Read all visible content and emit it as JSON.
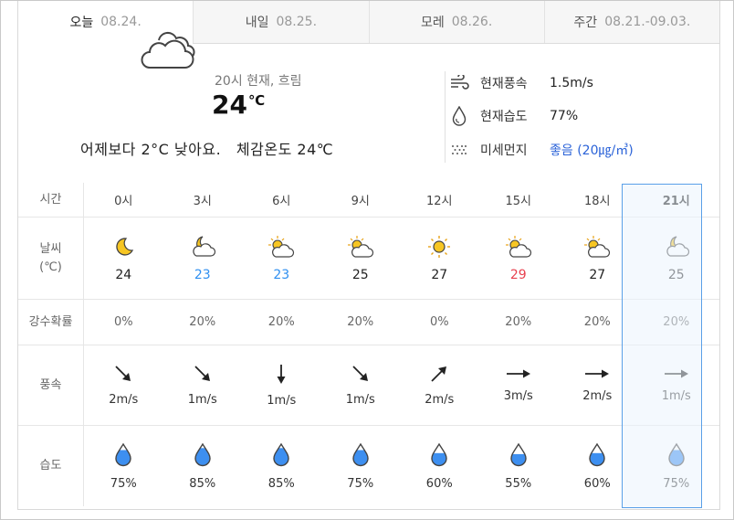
{
  "tabs": [
    {
      "label": "오늘",
      "date": "08.24.",
      "active": true
    },
    {
      "label": "내일",
      "date": "08.25.",
      "active": false
    },
    {
      "label": "모레",
      "date": "08.26.",
      "active": false
    },
    {
      "label": "주간",
      "date": "08.21.-09.03.",
      "active": false
    }
  ],
  "current": {
    "desc": "20시 현재, 흐림",
    "temp": "24",
    "unit": "℃",
    "compare": "어제보다 2°C 낮아요.",
    "feels": "체감온도 24℃",
    "icon": "cloudy-icon",
    "wind_label": "현재풍속",
    "wind_value": "1.5m/s",
    "humidity_label": "현재습도",
    "humidity_value": "77%",
    "dust_label": "미세먼지",
    "dust_value": "좋음 (20㎍/㎥)",
    "dust_color": "#2b63d8"
  },
  "rows": {
    "time_label": "시간",
    "weather_label": "날씨\n(℃)",
    "weather_label_1": "날씨",
    "weather_label_2": "(℃)",
    "rain_label": "강수확률",
    "wind_label": "풍속",
    "humidity_label": "습도"
  },
  "hours": [
    {
      "time": "0시",
      "icon": "moon-icon",
      "temp": "24",
      "temp_class": "",
      "rain": "0%",
      "wind_dir": "arrow-down-right-icon",
      "wind": "2m/s",
      "humidity": "75%"
    },
    {
      "time": "3시",
      "icon": "moon-cloud-icon",
      "temp": "23",
      "temp_class": "cold",
      "rain": "20%",
      "wind_dir": "arrow-down-right-icon",
      "wind": "1m/s",
      "humidity": "85%"
    },
    {
      "time": "6시",
      "icon": "sun-cloud-icon",
      "temp": "23",
      "temp_class": "cold",
      "rain": "20%",
      "wind_dir": "arrow-down-icon",
      "wind": "1m/s",
      "humidity": "85%"
    },
    {
      "time": "9시",
      "icon": "sun-cloud-icon",
      "temp": "25",
      "temp_class": "",
      "rain": "20%",
      "wind_dir": "arrow-down-right-icon",
      "wind": "1m/s",
      "humidity": "75%"
    },
    {
      "time": "12시",
      "icon": "sun-icon",
      "temp": "27",
      "temp_class": "",
      "rain": "0%",
      "wind_dir": "arrow-up-right-icon",
      "wind": "2m/s",
      "humidity": "60%"
    },
    {
      "time": "15시",
      "icon": "sun-cloud-icon",
      "temp": "29",
      "temp_class": "hot",
      "rain": "20%",
      "wind_dir": "arrow-right-icon",
      "wind": "3m/s",
      "humidity": "55%"
    },
    {
      "time": "18시",
      "icon": "sun-cloud-icon",
      "temp": "27",
      "temp_class": "",
      "rain": "20%",
      "wind_dir": "arrow-right-icon",
      "wind": "2m/s",
      "humidity": "60%"
    },
    {
      "time": "21시",
      "icon": "moon-cloud-icon",
      "temp": "25",
      "temp_class": "",
      "rain": "20%",
      "wind_dir": "arrow-right-icon",
      "wind": "1m/s",
      "humidity": "75%",
      "selected": true
    }
  ],
  "humidity_levels": [
    0.75,
    0.85,
    0.85,
    0.75,
    0.6,
    0.55,
    0.6,
    0.75
  ],
  "colors": {
    "cold": "#2f8ff0",
    "hot": "#e8414f",
    "accent": "#5aa0e8",
    "drop": "#3d8ff0"
  }
}
